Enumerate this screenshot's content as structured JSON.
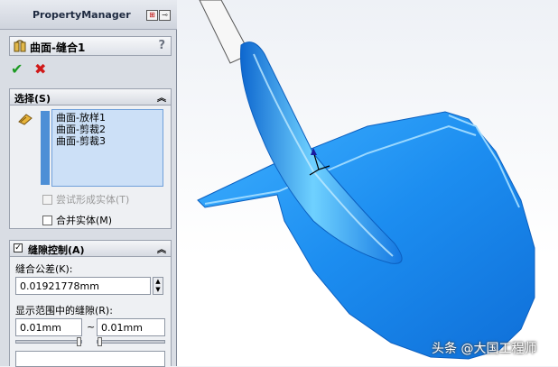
{
  "property_manager": {
    "title": "PropertyManager",
    "feature_name": "曲面-缝合1",
    "help": "?"
  },
  "selection": {
    "header": "选择(S)",
    "items": [
      "曲面-放样1",
      "曲面-剪裁2",
      "曲面-剪裁3"
    ],
    "try_solid": "尝试形成实体(T)",
    "merge_entities": "合并实体(M)"
  },
  "gap_control": {
    "header": "缝隙控制(A)",
    "tolerance_label": "缝合公差(K):",
    "tolerance_value": "0.01921778mm",
    "range_label": "显示范围中的缝隙(R):",
    "range_min": "0.01mm",
    "range_separator": "~",
    "range_max": "0.01mm"
  },
  "watermark": {
    "text": "头条 @大国工程师"
  },
  "colors": {
    "surface_blue": "#1c8df0",
    "selection_fill": "#cce0f7",
    "ok_green": "#1c9a22",
    "cancel_red": "#d01919"
  }
}
